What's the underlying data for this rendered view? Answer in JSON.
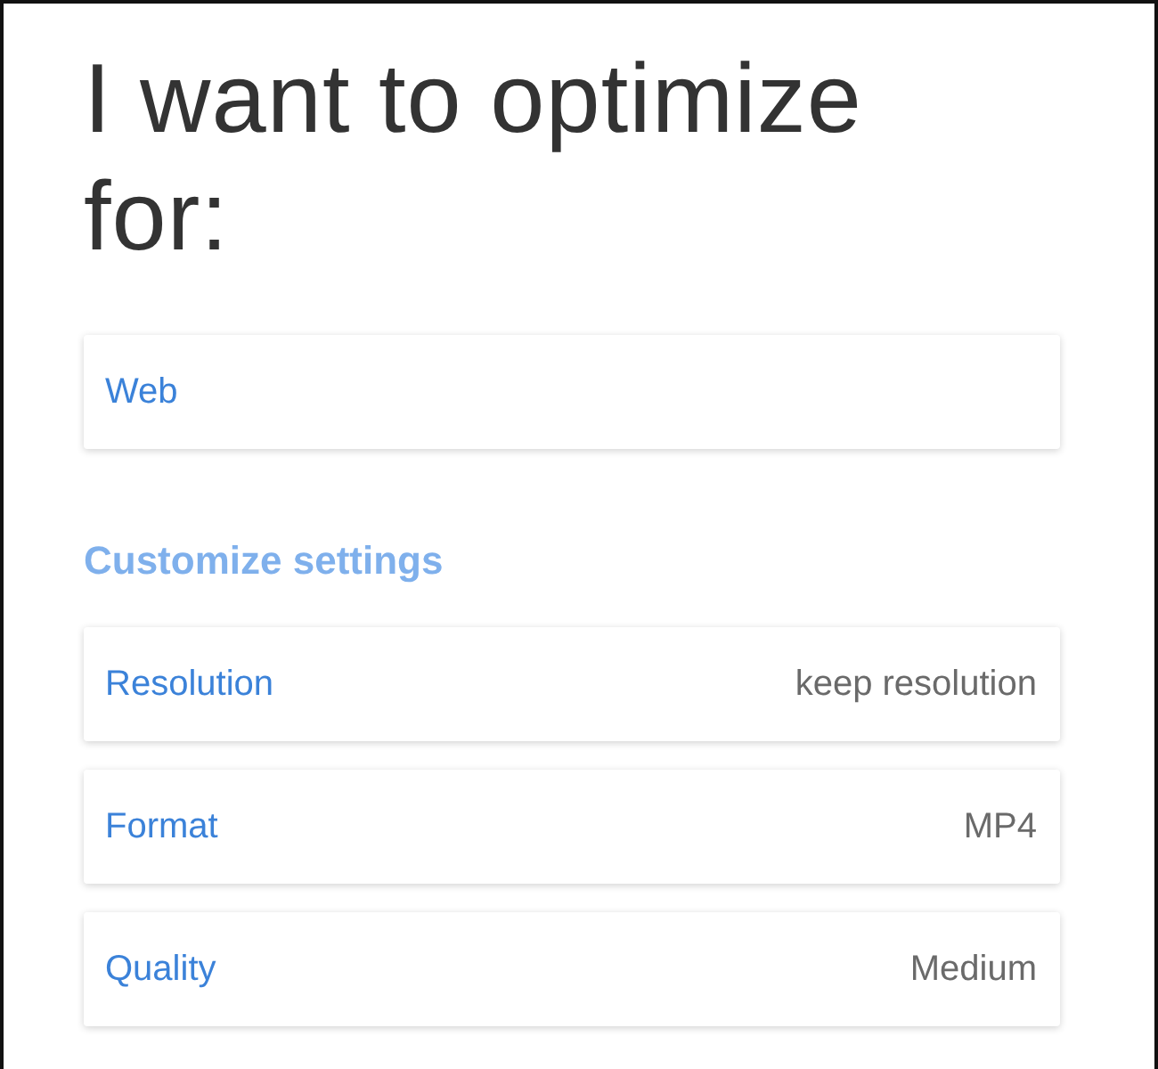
{
  "title": "I want to optimize for:",
  "target": {
    "label": "Web"
  },
  "section_heading": "Customize settings",
  "settings": [
    {
      "label": "Resolution",
      "value": "keep resolution"
    },
    {
      "label": "Format",
      "value": "MP4"
    },
    {
      "label": "Quality",
      "value": "Medium"
    }
  ]
}
